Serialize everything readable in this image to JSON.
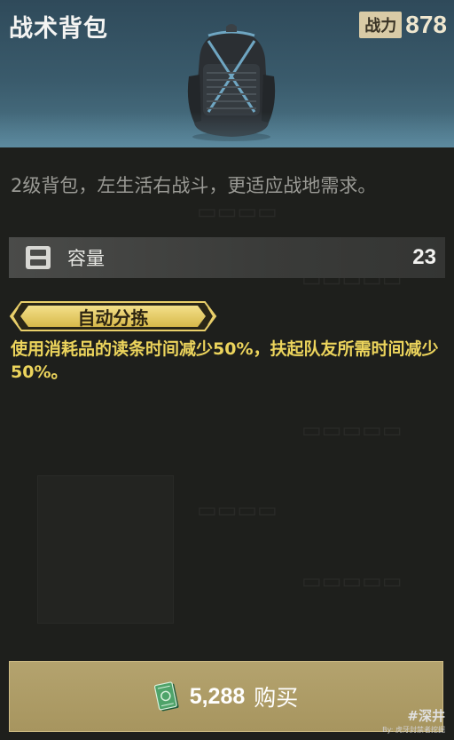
{
  "item": {
    "title": "战术背包",
    "power_label": "战力",
    "power_value": "878",
    "description": "2级背包，左生活右战斗，更适应战地需求。"
  },
  "stat": {
    "icon": "backpack-capacity-icon",
    "label": "容量",
    "value": "23"
  },
  "feature": {
    "badge": "自动分拣",
    "effect": "使用消耗品的读条时间减少50%，扶起队友所需时间减少50%。"
  },
  "buy_button": {
    "icon": "cash-icon",
    "price": "5,288",
    "label": "购买"
  },
  "watermark": {
    "logo": "#深井",
    "by": "By: 虎牙封禁者挖掘"
  },
  "colors": {
    "header_top": "#2f4a5a",
    "header_bottom": "#4d7688",
    "effect_text": "#ecd45c",
    "badge_gold": "#e9cf6a",
    "buy_button": "#b4a36e"
  }
}
